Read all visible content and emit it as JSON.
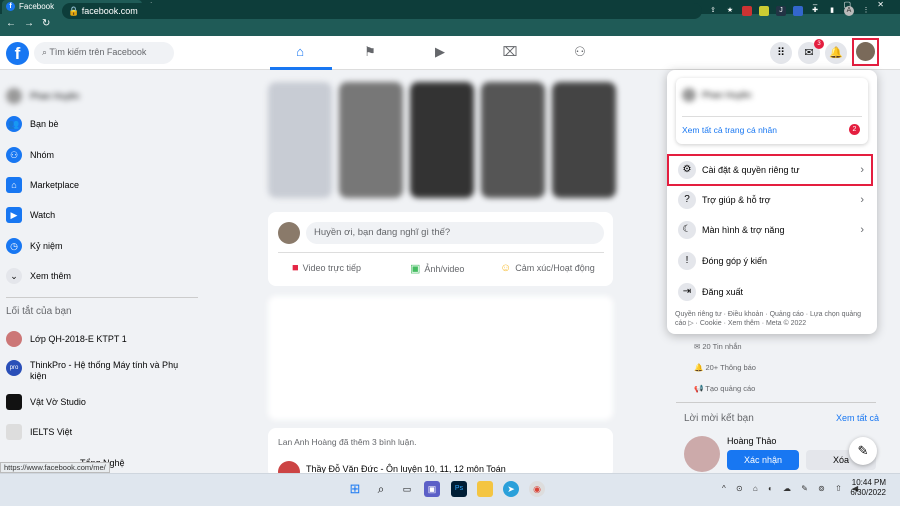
{
  "browser": {
    "tab_title": "Facebook",
    "tab_close": "×",
    "new_tab": "+",
    "window_controls": "– ▢ ✕",
    "url": "facebook.com",
    "status_url": "https://www.facebook.com/me/"
  },
  "header": {
    "logo": "f",
    "search_placeholder": "Tìm kiếm trên Facebook",
    "messenger_badge": "3"
  },
  "sidebar": {
    "profile_name": "Phan Huyền",
    "items": [
      {
        "label": "Bạn bè"
      },
      {
        "label": "Nhóm"
      },
      {
        "label": "Marketplace"
      },
      {
        "label": "Watch"
      },
      {
        "label": "Kỷ niệm"
      },
      {
        "label": "Xem thêm"
      }
    ],
    "shortcuts_title": "Lối tắt của bạn",
    "shortcuts": [
      {
        "label": "Lớp QH-2018-E KTPT 1"
      },
      {
        "label": "ThinkPro - Hệ thống Máy tính và Phụ kiện"
      },
      {
        "label": "Vật Vờ Studio"
      },
      {
        "label": "IELTS Việt"
      },
      {
        "label": "Tổng Nghệ"
      }
    ]
  },
  "composer": {
    "placeholder": "Huyền ơi, bạn đang nghĩ gì thế?",
    "live_video": "Video trực tiếp",
    "photo_video": "Ảnh/video",
    "feeling": "Cảm xúc/Hoạt động"
  },
  "feed": {
    "activity": "Lan Anh Hoàng đã thêm 3 bình luận.",
    "post_title": "Thầy Đỗ Văn Đức - Ôn luyện 10, 11, 12 môn Toán"
  },
  "dropdown": {
    "profile_name": "Phan Huyền",
    "see_all_profiles": "Xem tất cả trang cá nhân",
    "see_all_badge": "2",
    "items": [
      {
        "label": "Cài đặt & quyền riêng tư"
      },
      {
        "label": "Trợ giúp & hỗ trợ"
      },
      {
        "label": "Màn hình & trợ năng"
      },
      {
        "label": "Đóng góp ý kiến"
      },
      {
        "label": "Đăng xuất"
      }
    ],
    "footer": "Quyền riêng tư · Điều khoản · Quảng cáo · Lựa chọn quảng cáo ▷ · Cookie · Xem thêm · Meta © 2022"
  },
  "right_panel": {
    "messages": "20 Tin nhắn",
    "notifications": "20+ Thông báo",
    "create_ad": "Tạo quảng cáo",
    "friend_requests_title": "Lời mời kết bạn",
    "see_all": "Xem tất cả",
    "friend_name": "Hoàng Thảo",
    "confirm": "Xác nhận",
    "delete": "Xóa"
  },
  "taskbar": {
    "time": "10:44 PM",
    "date": "6/30/2022",
    "tray": "^ ⊙ ⌂ ◐ ☁ ✎ ⊚ ⇧ ◀"
  },
  "colors": {
    "brand": "#1877f2",
    "alert": "#e41e3f"
  }
}
